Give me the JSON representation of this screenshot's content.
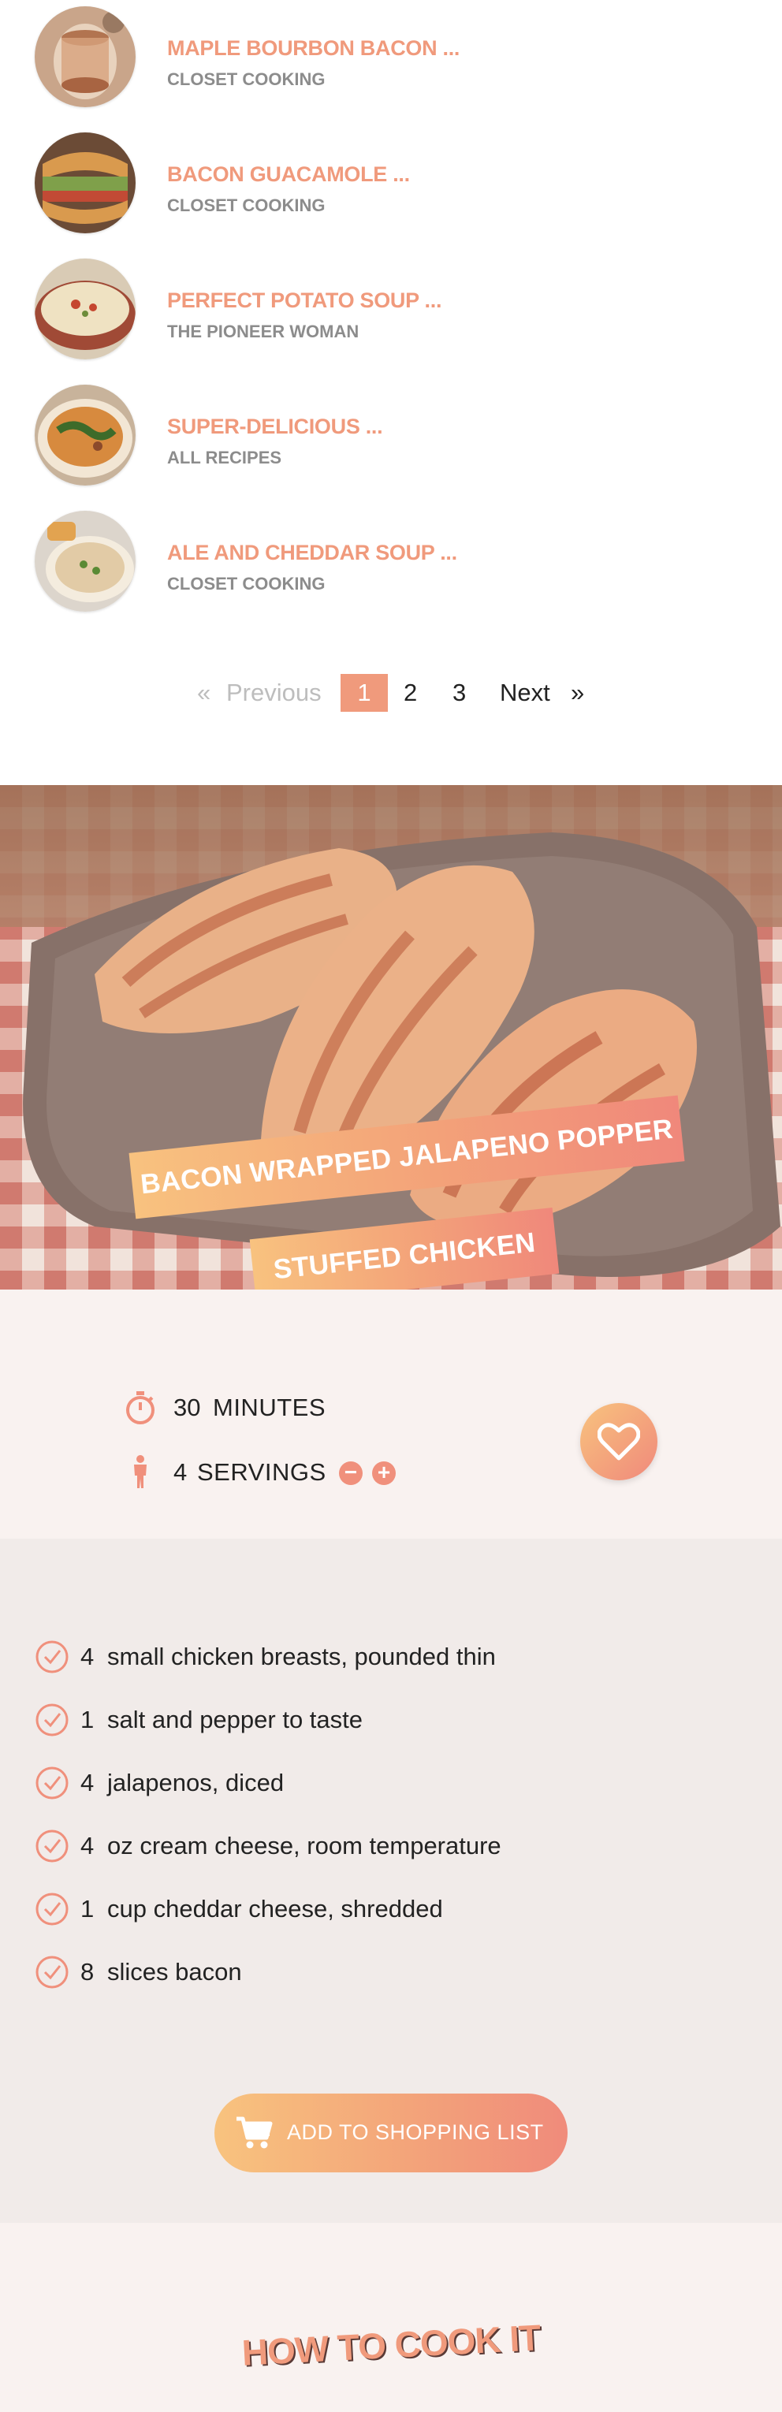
{
  "recipes": [
    {
      "title": "MAPLE BOURBON BACON ...",
      "source": "CLOSET COOKING",
      "thumb_icon": "maple-bourbon-bacon-photo"
    },
    {
      "title": "BACON GUACAMOLE ...",
      "source": "CLOSET COOKING",
      "thumb_icon": "bacon-guacamole-photo"
    },
    {
      "title": "PERFECT POTATO SOUP ...",
      "source": "THE PIONEER WOMAN",
      "thumb_icon": "potato-soup-photo"
    },
    {
      "title": "SUPER-DELICIOUS ...",
      "source": "ALL RECIPES",
      "thumb_icon": "soup-photo"
    },
    {
      "title": "ALE AND CHEDDAR SOUP ...",
      "source": "CLOSET COOKING",
      "thumb_icon": "cheddar-soup-photo"
    }
  ],
  "pagination": {
    "prev_arrow": "«",
    "previous": "Previous",
    "pages": [
      "1",
      "2",
      "3"
    ],
    "current": "1",
    "next": "Next",
    "next_arrow": "»"
  },
  "hero": {
    "title_line1": "BACON WRAPPED JALAPENO POPPER",
    "title_line2": "STUFFED CHICKEN"
  },
  "meta": {
    "time_value": "30",
    "time_unit": "MINUTES",
    "servings_value": "4",
    "servings_unit": "SERVINGS",
    "minus_label": "−",
    "plus_label": "+"
  },
  "ingredients": [
    {
      "qty": "4",
      "text": "small chicken breasts, pounded thin"
    },
    {
      "qty": "1",
      "text": "salt and pepper to taste"
    },
    {
      "qty": "4",
      "text": "jalapenos, diced"
    },
    {
      "qty": "4",
      "text": "oz cream cheese, room temperature"
    },
    {
      "qty": "1",
      "text": "cup cheddar cheese, shredded"
    },
    {
      "qty": "8",
      "text": "slices bacon"
    }
  ],
  "shopping": {
    "label": "ADD TO SHOPPING LIST"
  },
  "howto": {
    "title": "HOW TO COOK IT"
  },
  "colors": {
    "accent": "#f09a7c",
    "gradient_start": "#f8c37e",
    "gradient_end": "#f0897b",
    "meta_bg": "#f9f2f0",
    "ingredients_bg": "#f1ebe9"
  }
}
